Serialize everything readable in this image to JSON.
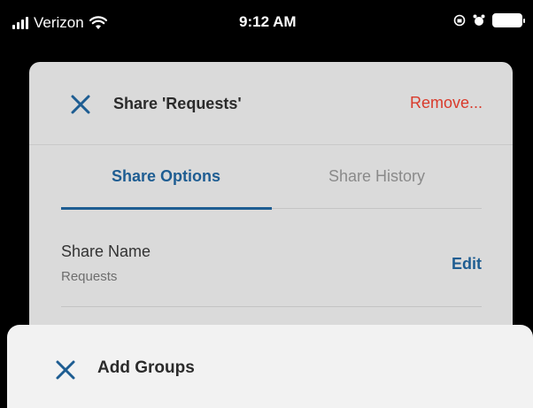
{
  "status_bar": {
    "carrier": "Verizon",
    "time": "9:12 AM"
  },
  "share_card": {
    "title": "Share 'Requests'",
    "remove_label": "Remove...",
    "tabs": [
      {
        "label": "Share Options",
        "active": true
      },
      {
        "label": "Share History",
        "active": false
      }
    ],
    "share_name": {
      "label": "Share Name",
      "value": "Requests",
      "edit_label": "Edit"
    }
  },
  "bottom_sheet": {
    "title": "Add Groups"
  },
  "colors": {
    "accent": "#1e5d92",
    "danger": "#d93a2b"
  }
}
